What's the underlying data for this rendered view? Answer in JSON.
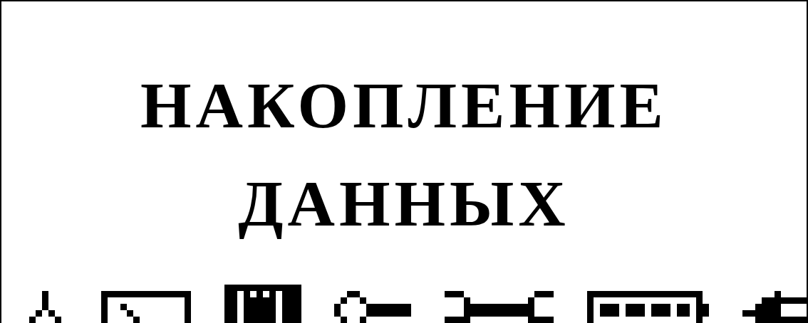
{
  "screen": {
    "title_lines": [
      "НАКОПЛЕНИЕ",
      "ДАННЫХ"
    ]
  }
}
